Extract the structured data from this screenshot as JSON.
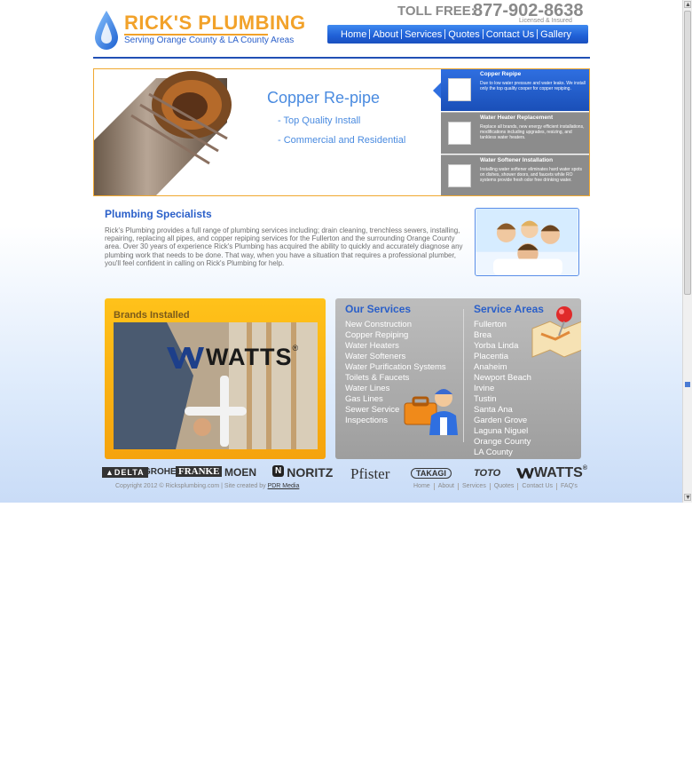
{
  "header": {
    "logo_title": "RICK'S PLUMBING",
    "logo_subtitle": "Serving Orange County & LA County Areas",
    "toll_free_label": "TOLL FREE:",
    "phone": "877-902-8638",
    "licensed": "Licensed & Insured"
  },
  "nav": [
    "Home",
    "About",
    "Services",
    "Quotes",
    "Contact Us",
    "Gallery"
  ],
  "slider": {
    "headline": "Copper Re-pipe",
    "bullets": [
      "- Top Quality Install",
      "- Commercial and Residential"
    ],
    "panels": [
      {
        "title": "Copper Repipe",
        "desc": "Due to low water pressure and water leaks. We install only the top quality cooper for copper repiping."
      },
      {
        "title": "Water Heater Replacement",
        "desc": "Replace all brands, new energy efficient installations, modifications including upgrades, resizing, and tankless water heaters."
      },
      {
        "title": "Water Softener Installation",
        "desc": "Installing water softener eliminates hard water spots on dishes, shower doors, and faucets while RO systems provide fresh odor free drinking water."
      }
    ]
  },
  "specialists": {
    "title": "Plumbing Specialists",
    "body": "Rick's Plumbing provides a full range of plumbing services including; drain cleaning, trenchless sewers, installing, repairing, replacing all pipes, and copper repiping services for the Fullerton and the surrounding Orange County area. Over 30 years of experience Rick's Plumbing has acquired the ability to quickly and accurately diagnose any plumbing work that needs to be done. That way, when you have a situation that requires a professional plumber, you'll feel confident in calling on Rick's Plumbing for help."
  },
  "brands": {
    "title": "Brands Installed",
    "featured": "WATTS"
  },
  "services": {
    "title": "Our Services",
    "items": [
      "New Construction",
      "Copper Repiping",
      "Water Heaters",
      "Water Softeners",
      "Water Purification Systems",
      "Toilets & Faucets",
      "Water Lines",
      "Gas Lines",
      "Sewer Service",
      "Inspections"
    ]
  },
  "areas": {
    "title": "Service Areas",
    "items": [
      "Fullerton",
      "Brea",
      "Yorba Linda",
      "Placentia",
      "Anaheim",
      "Newport Beach",
      "Irvine",
      "Tustin",
      "Santa Ana",
      "Garden Grove",
      "Laguna Niguel",
      "Orange County",
      "LA County"
    ]
  },
  "brand_logos": [
    "DELTA",
    "GROHE",
    "FRANKE",
    "MOEN",
    "NORITZ",
    "Pfister",
    "TAKAGI",
    "TOTO",
    "WATTS"
  ],
  "footer": {
    "copyright": "Copyright 2012 © Ricksplumbing.com  |  Site created by",
    "creator": "PDR Media",
    "links": [
      "Home",
      "About",
      "Services",
      "Quotes",
      "Contact Us",
      "FAQ's"
    ]
  },
  "colors": {
    "accent_blue": "#2a5fc9",
    "accent_orange": "#f2a22a",
    "nav_blue": "#1f5fd6",
    "panel_grey": "#9e9e9e"
  }
}
